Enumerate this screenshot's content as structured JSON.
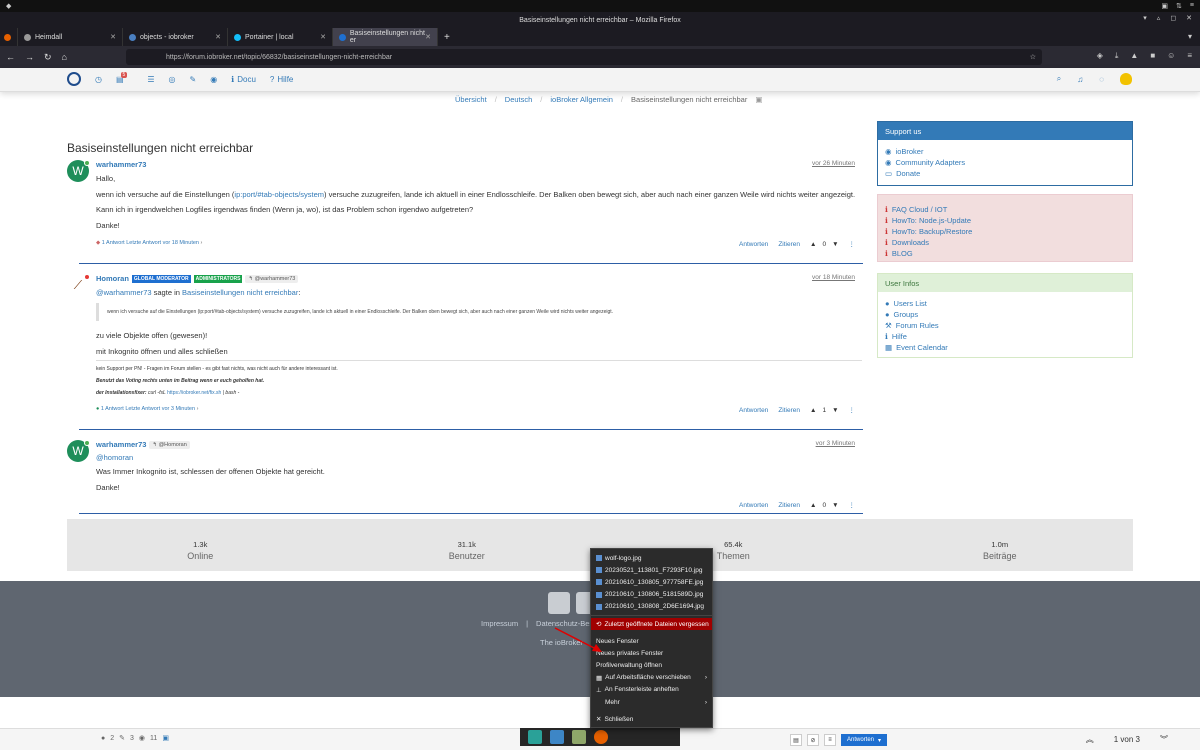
{
  "browser": {
    "window_title": "Basiseinstellungen nicht erreichbar – Mozilla Firefox",
    "tabs": [
      {
        "label": "Heimdall"
      },
      {
        "label": "objects - iobroker"
      },
      {
        "label": "Portainer | local"
      },
      {
        "label": "Basiseinstellungen nicht er"
      }
    ],
    "url": "https://forum.iobroker.net/topic/66832/basiseinstellungen-nicht-erreichbar"
  },
  "header": {
    "notification_count": "5",
    "docu_label": "Docu",
    "hilfe_label": "Hilfe"
  },
  "breadcrumb": [
    "Übersicht",
    "Deutsch",
    "ioBroker Allgemein",
    "Basiseinstellungen nicht erreichbar"
  ],
  "topic": {
    "title": "Basiseinstellungen nicht erreichbar"
  },
  "posts": [
    {
      "author": "warhammer73",
      "avatar_letter": "W",
      "time": "vor 26 Minuten",
      "lines": [
        "Hallo,",
        "wenn ich versuche auf die Einstellungen (",
        "ip:port/#tab-objects/system",
        ") versuche zuzugreifen, lande ich aktuell in einer Endlosschleife. Der Balken oben bewegt sich, aber auch nach einer ganzen Weile wird nichts weiter angezeigt.",
        "Kann ich in irgendwelchen Logfiles irgendwas finden (Wenn ja, wo), ist das Problem schon irgendwo aufgetreten?",
        "Danke!"
      ],
      "footer": "1 Antwort Letzte Antwort vor 18 Minuten",
      "votes": "0"
    },
    {
      "author": "Homoran",
      "roles": [
        "GLOBAL MODERATOR",
        "ADMINISTRATORS"
      ],
      "reply_to": "@warhammer73",
      "time": "vor 18 Minuten",
      "mention": "@warhammer73",
      "said_in": "sagte in",
      "said_topic": "Basiseinstellungen nicht erreichbar",
      "quote": "wenn ich versuche auf die Einstellungen (ip:port/#tab-objects/system) versuche zuzugreifen, lande ich aktuell in einer Endlosschleife. Der Balken oben bewegt sich, aber auch nach einer ganzen Weile wird nichts weiter angezeigt.",
      "lines": [
        "zu viele Objekte offen (gewesen)!",
        "mit Inkognito öffnen und alles schließen"
      ],
      "signature": [
        "kein Support per PN! - Fragen im Forum stellen - es gibt fast nichts, was nicht auch für andere interessant ist.",
        "Benutzt das Voting rechts unten im Beitrag wenn er euch geholfen hat.",
        "der Installationsfixer:",
        "curl -fsL",
        "https://iobroker.net/fix.sh",
        "| bash -"
      ],
      "footer": "1 Antwort Letzte Antwort vor 3 Minuten",
      "votes": "1"
    },
    {
      "author": "warhammer73",
      "avatar_letter": "W",
      "reply_to": "@Homoran",
      "time": "vor 3 Minuten",
      "mention": "@homoran",
      "lines": [
        "Was Immer Inkognito ist, schlessen der offenen Objekte hat gereicht.",
        "Danke!"
      ],
      "votes": "0"
    }
  ],
  "post_actions": {
    "reply": "Antworten",
    "quote": "Zitieren"
  },
  "sidebar": {
    "support": {
      "title": "Support us",
      "items": [
        "ioBroker",
        "Community Adapters",
        "Donate"
      ]
    },
    "links": {
      "items": [
        "FAQ Cloud / IOT",
        "HowTo: Node.js-Update",
        "HowTo: Backup/Restore",
        "Downloads",
        "BLOG"
      ]
    },
    "user_infos": {
      "title": "User Infos",
      "items": [
        "Users List",
        "Groups",
        "Forum Rules",
        "Hilfe",
        "Event Calendar"
      ]
    }
  },
  "stats": [
    {
      "value": "1.3k",
      "label": "Online"
    },
    {
      "value": "31.1k",
      "label": "Benutzer"
    },
    {
      "value": "65.4k",
      "label": "Themen"
    },
    {
      "value": "1.0m",
      "label": "Beiträge"
    }
  ],
  "footer": {
    "impressum": "Impressum",
    "datenschutz": "Datenschutz-Bes",
    "powered": "The ioBroker"
  },
  "bottom_bar": {
    "posters": "2",
    "posts": "3",
    "views": "11",
    "reply_button": "Antworten",
    "pager": "1 von 3"
  },
  "context_menu": {
    "files": [
      "wolf-logo.jpg",
      "20230521_113801_F7293F10.jpg",
      "20210610_130805_977758FE.jpg",
      "20210610_130806_5181589D.jpg",
      "20210610_130808_2D6E1694.jpg"
    ],
    "forget": "Zuletzt geöffnete Dateien vergessen",
    "new_window": "Neues Fenster",
    "new_private": "Neues privates Fenster",
    "profiles": "Profilverwaltung öffnen",
    "move_workspace": "Auf Arbeitsfläche verschieben",
    "pin": "An Fensterleiste anheften",
    "more": "Mehr",
    "close": "Schließen"
  }
}
